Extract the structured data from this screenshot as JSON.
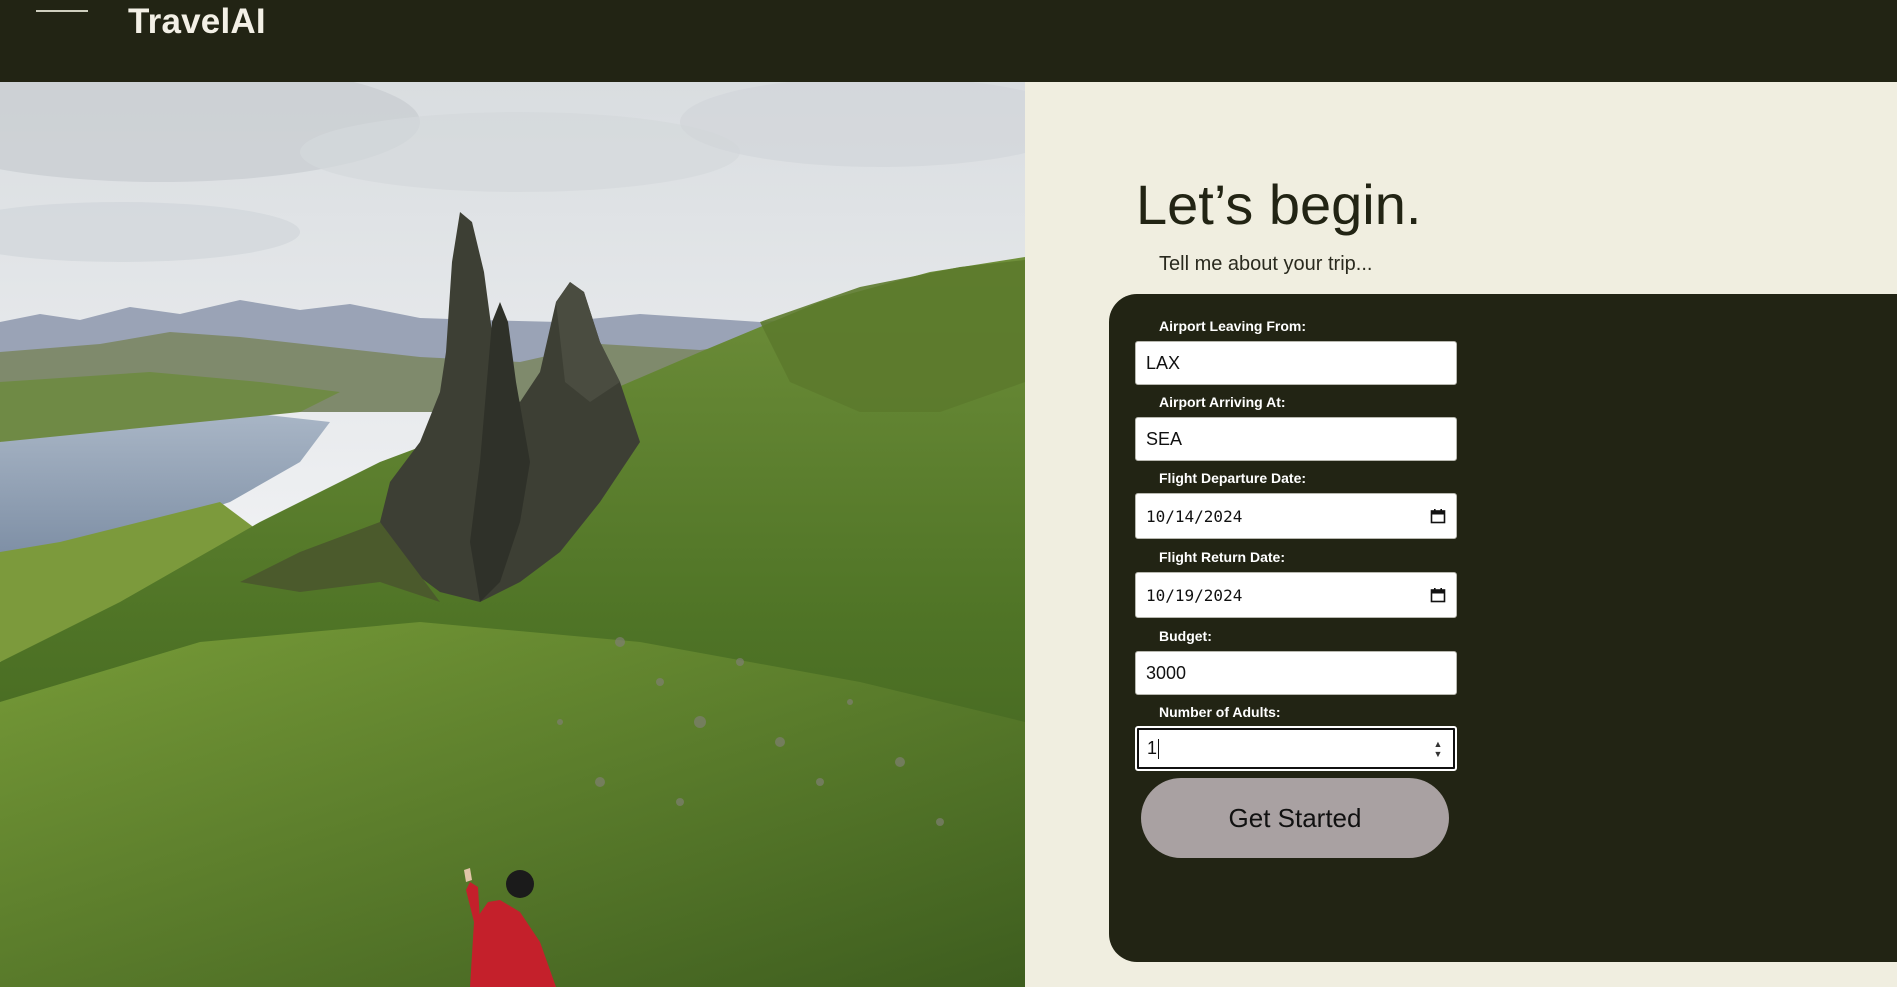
{
  "header": {
    "brand": "TravelAI",
    "menu_icon": "menu-icon"
  },
  "hero": {
    "image": "landscape-photo"
  },
  "intro": {
    "heading": "Let’s begin.",
    "subheading": "Tell me about your trip..."
  },
  "form": {
    "leaving_label": "Airport Leaving From:",
    "leaving_value": "LAX",
    "arriving_label": "Airport Arriving At:",
    "arriving_value": "SEA",
    "departure_label": "Flight Departure Date:",
    "departure_value": "10/14/2024",
    "return_label": "Flight Return Date:",
    "return_value": "10/19/2024",
    "budget_label": "Budget:",
    "budget_value": "3000",
    "adults_label": "Number of Adults:",
    "adults_value": "1",
    "submit_label": "Get Started",
    "date_icon": "calendar-icon",
    "stepper_icon": "spinner-icon"
  },
  "colors": {
    "dark": "#222414",
    "cream": "#f0eee0",
    "button": "#a9a1a2",
    "text_light": "#ffffff"
  }
}
